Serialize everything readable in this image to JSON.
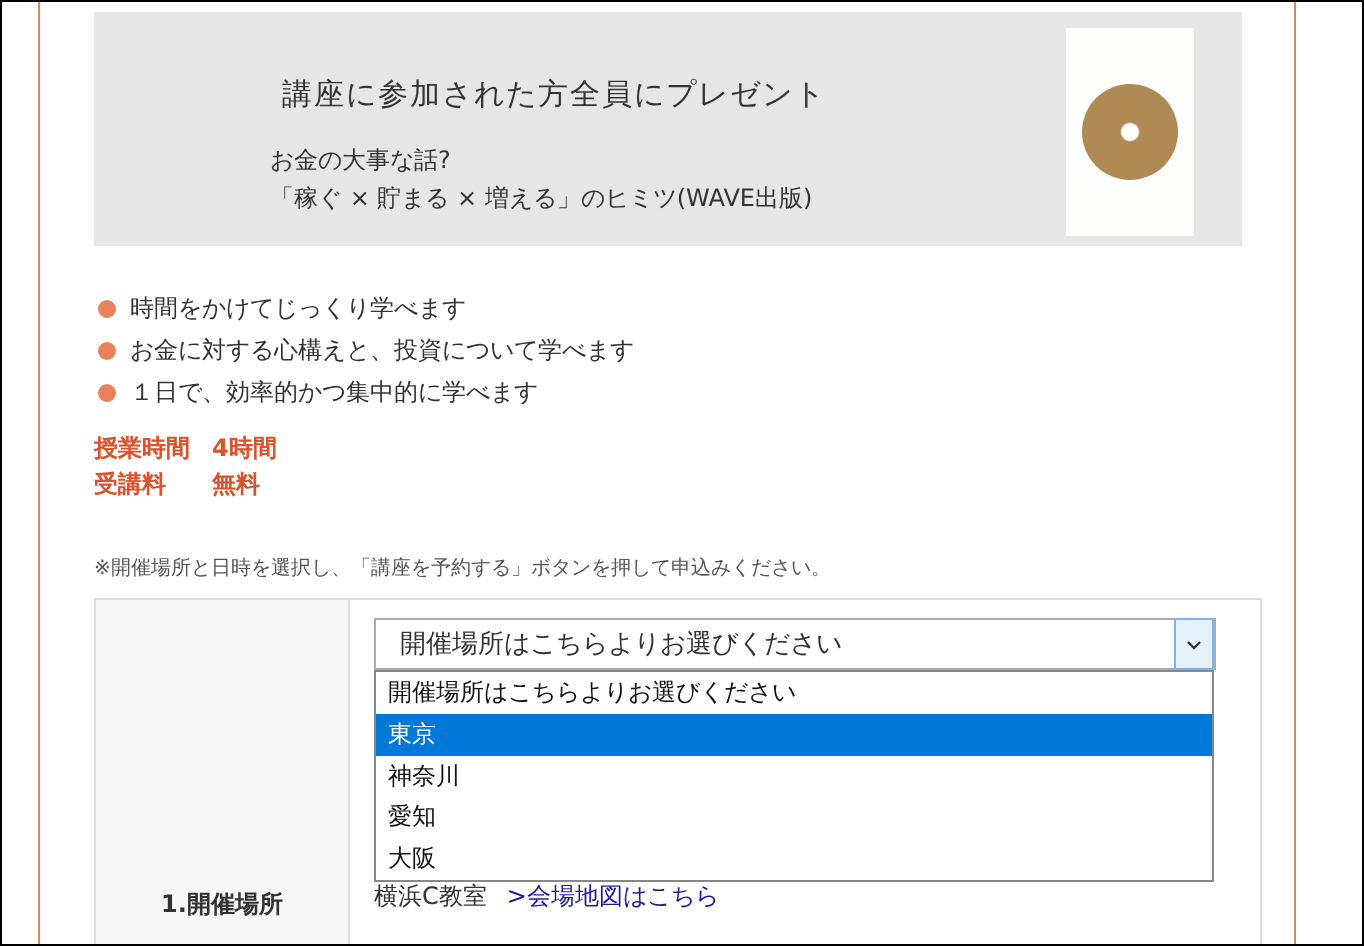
{
  "banner": {
    "heading": "講座に参加された方全員にプレゼント",
    "book_title": "お金の大事な話?",
    "book_subtitle": "「稼ぐ × 貯まる × 増える」のヒミツ(WAVE出版)"
  },
  "features": [
    "時間をかけてじっくり学べます",
    "お金に対する心構えと、投資について学べます",
    "１日で、効率的かつ集中的に学べます"
  ],
  "facts": [
    {
      "label": "授業時間",
      "value": "4時間"
    },
    {
      "label": "受講料",
      "value": "無料"
    }
  ],
  "note": "※開催場所と日時を選択し、「講座を予約する」ボタンを押して申込みください。",
  "form": {
    "row_label": "1.開催場所",
    "select": {
      "value": "開催場所はこちらよりお選びください",
      "expanded": true,
      "options": [
        {
          "label": "開催場所はこちらよりお選びください",
          "highlighted": false
        },
        {
          "label": "東京",
          "highlighted": true
        },
        {
          "label": "神奈川",
          "highlighted": false
        },
        {
          "label": "愛知",
          "highlighted": false
        },
        {
          "label": "大阪",
          "highlighted": false
        }
      ]
    },
    "venue": "横浜C教室",
    "map_link": ">会場地図はこちら"
  }
}
